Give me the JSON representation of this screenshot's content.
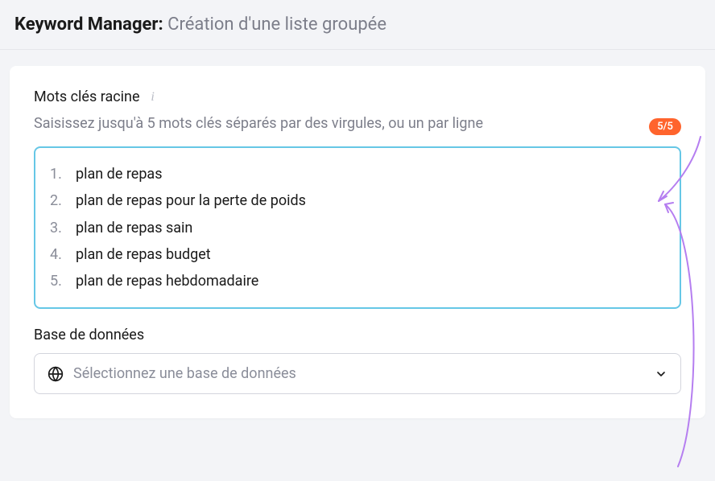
{
  "header": {
    "title_prefix": "Keyword Manager: ",
    "subtitle": "Création d'une liste groupée"
  },
  "root_keywords": {
    "label": "Mots clés racine",
    "hint": "Saisissez jusqu'à 5 mots clés séparés par des virgules, ou un par ligne",
    "counter": "5/5",
    "items": [
      "plan de repas",
      "plan de repas pour la perte de poids",
      "plan de repas sain",
      "plan de repas budget",
      "plan de repas hebdomadaire"
    ]
  },
  "database": {
    "label": "Base de données",
    "placeholder": "Sélectionnez une base de données"
  }
}
